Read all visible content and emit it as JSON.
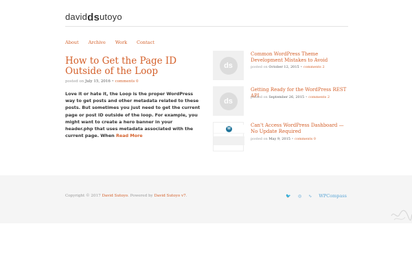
{
  "site": {
    "logo_prefix": "david",
    "logo_mark": "ds",
    "logo_suffix": "utoyo"
  },
  "nav": [
    "About",
    "Archive",
    "Work",
    "Contact"
  ],
  "post": {
    "title": "How to Get the Page ID Outside of the Loop",
    "posted_on": "posted on",
    "date": "July 15, 2016",
    "separator": " • ",
    "comments": "comments 0",
    "excerpt": "Love it or hate it, the Loop is the proper WordPress way to get posts and other metadata related to these posts. But sometimes you just need to get the current page or post ID outside of the loop. For example, you might want to create a hero banner in your header.php that uses metadata associated with the current page. When ",
    "read_more": "Read More"
  },
  "related": [
    {
      "title": "Common WordPress Theme Development Mistakes to Avoid",
      "posted_on": "posted on",
      "date": "October 12, 2015",
      "separator": " • ",
      "comments": "comments 2",
      "thumb": "ds"
    },
    {
      "title": "Getting Ready for the WordPress REST API",
      "posted_on": "posted on",
      "date": "September 26, 2015",
      "separator": " • ",
      "comments": "comments 2",
      "thumb": "ds"
    },
    {
      "title": "Can't Access WordPress Dashboard — No Update Required",
      "posted_on": "posted on",
      "date": "May 9, 2015",
      "separator": " • ",
      "comments": "comments 0",
      "thumb": "wordpress"
    }
  ],
  "footer": {
    "copyright": "Copyright © 2017 ",
    "author": "David Sutoyo",
    "powered": ". Powered by ",
    "powered_link": "David Sutoyo v7",
    "end": ".",
    "social_icons": [
      "twitter-icon",
      "dribbble-icon",
      "rss-icon"
    ],
    "social_glyphs": [
      "🐦",
      "◎",
      "∿"
    ],
    "wpcompass": "WPCompass"
  },
  "colors": {
    "accent": "#d4602a",
    "link_blue": "#5aa5d6",
    "footer_bg": "#f5f5f5"
  }
}
